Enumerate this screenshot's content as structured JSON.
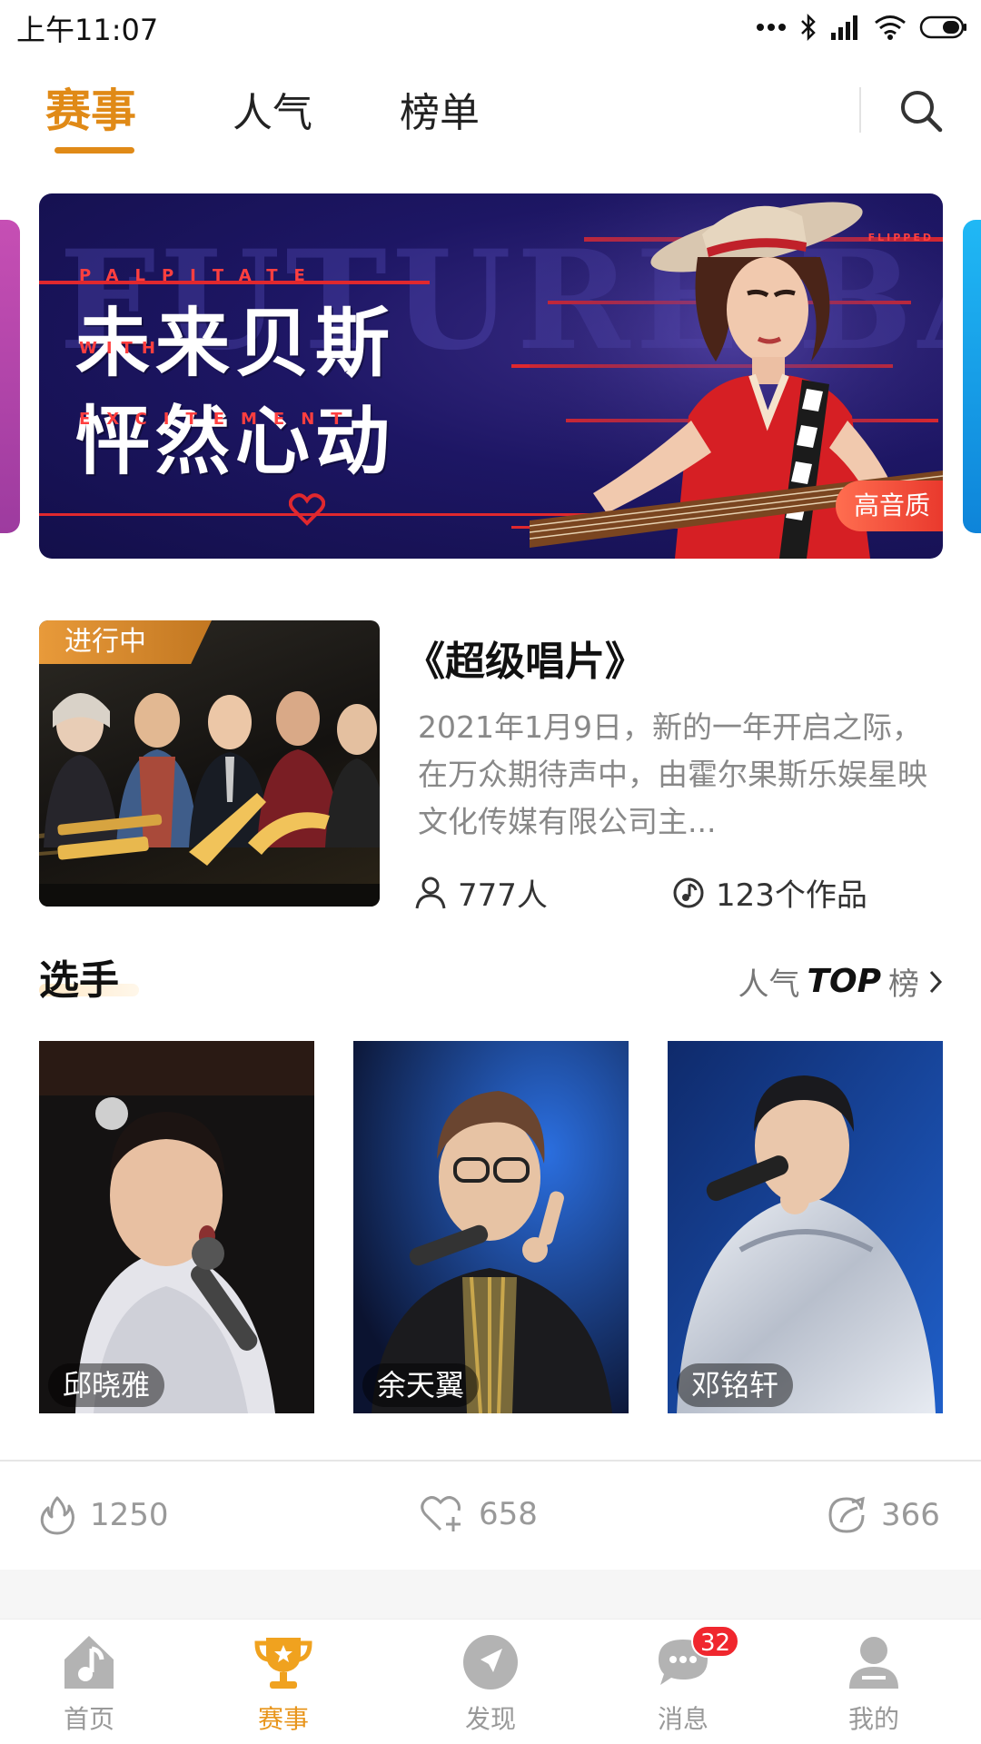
{
  "status_bar": {
    "time": "上午11:07"
  },
  "top_tabs": {
    "items": [
      "赛事",
      "人气",
      "榜单"
    ],
    "active": "赛事"
  },
  "banner": {
    "title_line1": "未来贝斯",
    "title_line2": "怦然心动",
    "en_top": "PALPITATE",
    "en_mid": "WITH",
    "en_bottom": "EXCITEMENT",
    "bg_word": "FUTURE BASS",
    "corner_word": "FLIPPED",
    "badge": "高音质"
  },
  "event": {
    "status": "进行中",
    "title": "《超级唱片》",
    "description": "2021年1月9日，新的一年开启之际，在万众期待声中，由霍尔果斯乐娱星映文化传媒有限公司主...",
    "participants": "777人",
    "works": "123个作品"
  },
  "players_section": {
    "title": "选手",
    "rank_prefix": "人气",
    "rank_top": "TOP",
    "rank_suffix": "榜",
    "players": [
      {
        "name": "邱晓雅"
      },
      {
        "name": "余天翼"
      },
      {
        "name": "邓铭轩"
      }
    ]
  },
  "stats": {
    "fire": "1250",
    "likes": "658",
    "shares": "366"
  },
  "bottom_nav": {
    "items": [
      "首页",
      "赛事",
      "发现",
      "消息",
      "我的"
    ],
    "active": "赛事",
    "message_badge": "32"
  },
  "colors": {
    "accent": "#e08a17",
    "badge_red": "#f0272e",
    "banner_red": "#e0282e"
  }
}
